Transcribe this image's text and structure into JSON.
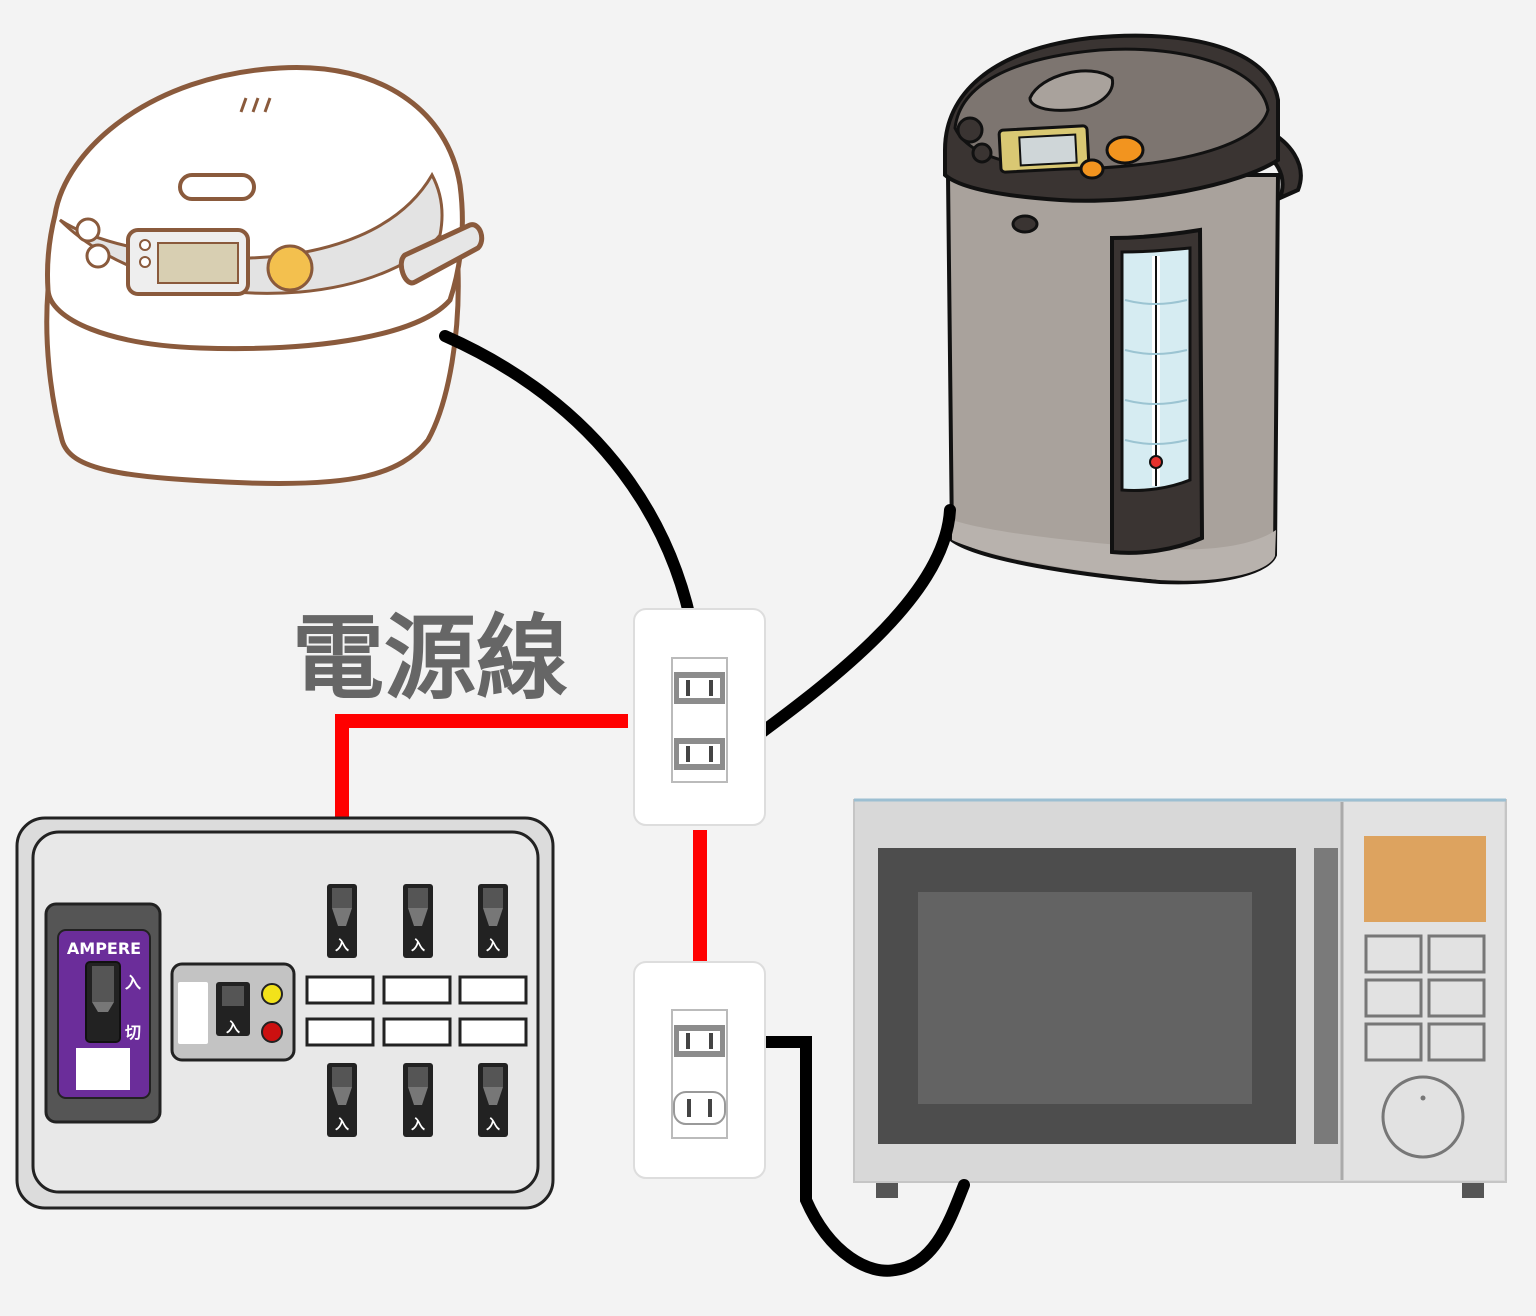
{
  "diagram": {
    "label": "電源線"
  },
  "breaker_panel": {
    "main_label": "AMPERE",
    "on_label": "入",
    "off_label": "切",
    "switch_on_label": "入"
  },
  "colors": {
    "background": "#f3f3f3",
    "power_line": "#ff0000",
    "cord": "#000000",
    "label_text": "#666666",
    "breaker_purple": "#6b2d9a",
    "rice_cooker_outline": "#8a5a3c",
    "rice_cooker_button": "#f3c04e",
    "pot_body": "#a9a29c",
    "pot_button": "#f2941f",
    "microwave_panel": "#dda35f"
  },
  "icons": {
    "rice_cooker": "rice-cooker-icon",
    "electric_pot": "electric-pot-icon",
    "microwave": "microwave-icon",
    "breaker": "breaker-panel-icon",
    "outlet": "wall-outlet-icon"
  }
}
